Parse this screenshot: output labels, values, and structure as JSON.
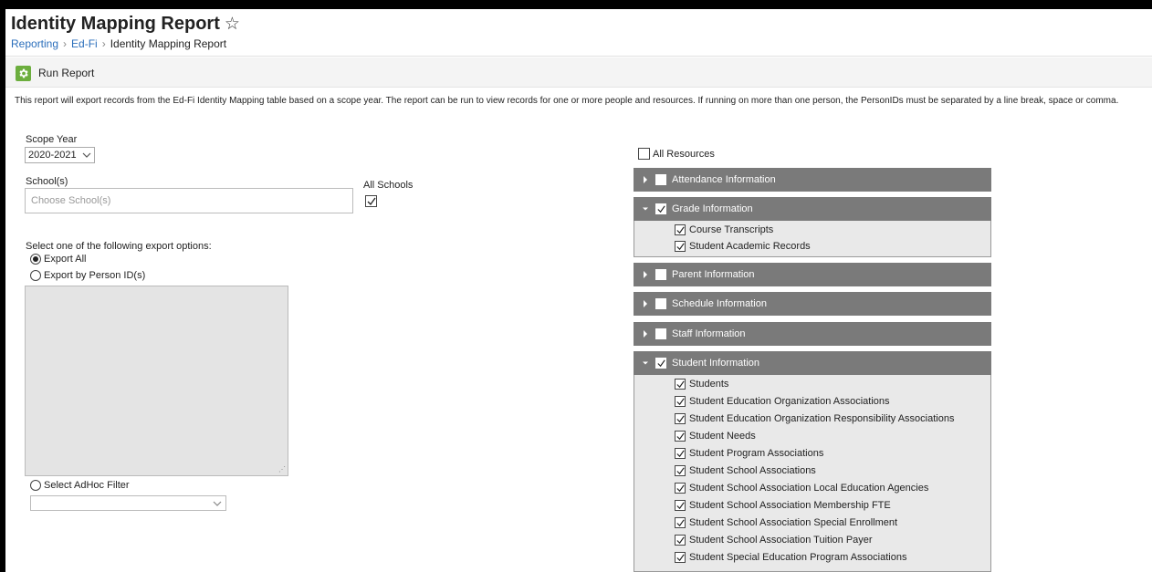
{
  "header": {
    "title": "Identity Mapping Report",
    "breadcrumb": [
      "Reporting",
      "Ed-Fi",
      "Identity Mapping Report"
    ]
  },
  "toolbar": {
    "run_label": "Run Report"
  },
  "description": "This report will export records from the Ed-Fi Identity Mapping table based on a scope year. The report can be run to view records for one or more people and resources. If running on more than one person, the PersonIDs must be separated by a line break, space or comma.",
  "scope_year": {
    "label": "Scope Year",
    "value": "2020-2021"
  },
  "schools": {
    "label": "School(s)",
    "placeholder": "Choose School(s)",
    "all_label": "All Schools",
    "all_checked": true
  },
  "export": {
    "prompt": "Select one of the following export options:",
    "options": [
      {
        "label": "Export All",
        "selected": true
      },
      {
        "label": "Export by Person ID(s)",
        "selected": false
      },
      {
        "label": "Select AdHoc Filter",
        "selected": false
      }
    ]
  },
  "resources": {
    "all_label": "All Resources",
    "all_checked": false,
    "groups": [
      {
        "label": "Attendance Information",
        "checked": false,
        "expanded": false,
        "items": []
      },
      {
        "label": "Grade Information",
        "checked": true,
        "expanded": true,
        "items": [
          "Course Transcripts",
          "Student Academic Records"
        ]
      },
      {
        "label": "Parent Information",
        "checked": false,
        "expanded": false,
        "items": []
      },
      {
        "label": "Schedule Information",
        "checked": false,
        "expanded": false,
        "items": []
      },
      {
        "label": "Staff Information",
        "checked": false,
        "expanded": false,
        "items": []
      },
      {
        "label": "Student Information",
        "checked": true,
        "expanded": true,
        "items": [
          "Students",
          "Student Education Organization Associations",
          "Student Education Organization Responsibility Associations",
          "Student Needs",
          "Student Program Associations",
          "Student School Associations",
          "Student School Association Local Education Agencies",
          "Student School Association Membership FTE",
          "Student School Association Special Enrollment",
          "Student School Association Tuition Payer",
          "Student Special Education Program Associations"
        ]
      }
    ]
  },
  "colors": {
    "accent_green": "#6cae3e",
    "panel_header": "#7a7a7a",
    "link_blue": "#2a6ebb"
  }
}
